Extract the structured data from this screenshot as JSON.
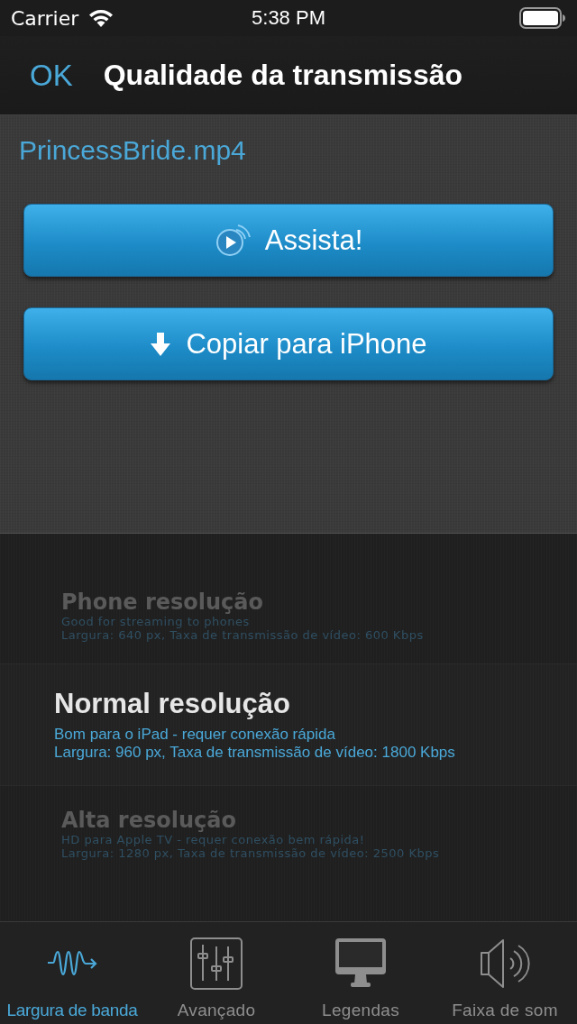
{
  "status_bar": {
    "carrier": "Carrier",
    "time": "5:38 PM"
  },
  "nav": {
    "back": "OK",
    "title": "Qualidade da transmissão"
  },
  "file_name": "PrincessBride.mp4",
  "actions": [
    {
      "kind": "play",
      "label": "Assista!"
    },
    {
      "kind": "download",
      "label": "Copiar para iPhone"
    }
  ],
  "qualities": [
    {
      "title": "Phone resolução",
      "description": "Good for streaming to phones",
      "details": "Largura: 640 px, Taxa de transmissão de vídeo: 600 Kbps",
      "selected": false
    },
    {
      "title": "Normal resolução",
      "description": "Bom para o iPad - requer conexão rápida",
      "details": "Largura: 960 px, Taxa de transmissão de vídeo: 1800 Kbps",
      "selected": true
    },
    {
      "title": "Alta resolução",
      "description": "HD para Apple TV - requer conexão bem rápida!",
      "details": "Largura: 1280 px, Taxa de transmissão de vídeo: 2500 Kbps",
      "selected": false
    }
  ],
  "tabs": [
    {
      "kind": "bandwidth",
      "label": "Largura de banda",
      "selected": true
    },
    {
      "kind": "advanced",
      "label": "Avançado",
      "selected": false
    },
    {
      "kind": "subtitles",
      "label": "Legendas",
      "selected": false
    },
    {
      "kind": "audio",
      "label": "Faixa de som",
      "selected": false
    }
  ]
}
